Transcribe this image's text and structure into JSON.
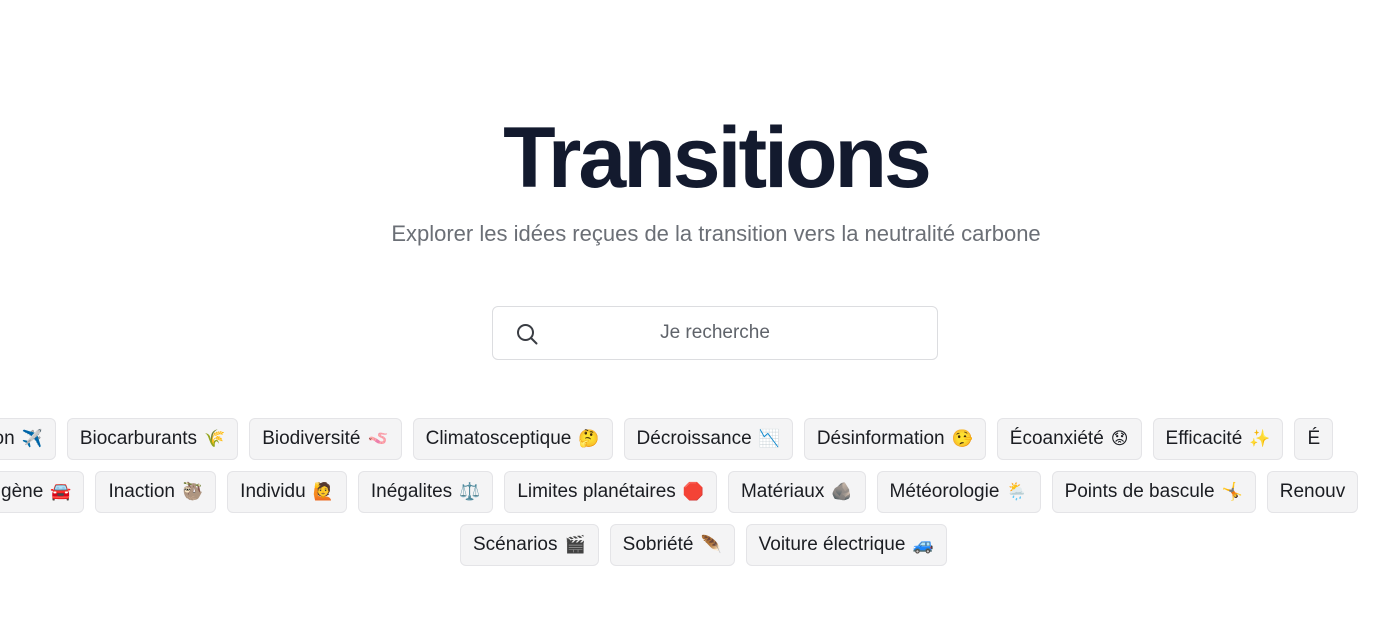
{
  "header": {
    "title": "Transitions",
    "subtitle": "Explorer les idées reçues de la transition vers la neutralité carbone"
  },
  "search": {
    "placeholder": "Je recherche",
    "icon": "search-icon"
  },
  "tags": {
    "row1": [
      {
        "label": "tion",
        "emoji": "✈️"
      },
      {
        "label": "Biocarburants",
        "emoji": "🌾"
      },
      {
        "label": "Biodiversité",
        "emoji": "🪱"
      },
      {
        "label": "Climatosceptique",
        "emoji": "🤔"
      },
      {
        "label": "Décroissance",
        "emoji": "📉"
      },
      {
        "label": "Désinformation",
        "emoji": "🤥"
      },
      {
        "label": "Écoanxiété",
        "emoji": "😟"
      },
      {
        "label": "Efficacité",
        "emoji": "✨"
      },
      {
        "label": "É",
        "emoji": ""
      }
    ],
    "row2": [
      {
        "label": "gène",
        "emoji": "🚘"
      },
      {
        "label": "Inaction",
        "emoji": "🦥"
      },
      {
        "label": "Individu",
        "emoji": "🙋"
      },
      {
        "label": "Inégalites",
        "emoji": "⚖️"
      },
      {
        "label": "Limites planétaires",
        "emoji": "🛑"
      },
      {
        "label": "Matériaux",
        "emoji": "🪨"
      },
      {
        "label": "Météorologie",
        "emoji": "🌦️"
      },
      {
        "label": "Points de bascule",
        "emoji": "🤸"
      },
      {
        "label": "Renouv",
        "emoji": ""
      }
    ],
    "row3": [
      {
        "label": "Scénarios",
        "emoji": "🎬"
      },
      {
        "label": "Sobriété",
        "emoji": "🪶"
      },
      {
        "label": "Voiture électrique",
        "emoji": "🚙"
      }
    ]
  }
}
